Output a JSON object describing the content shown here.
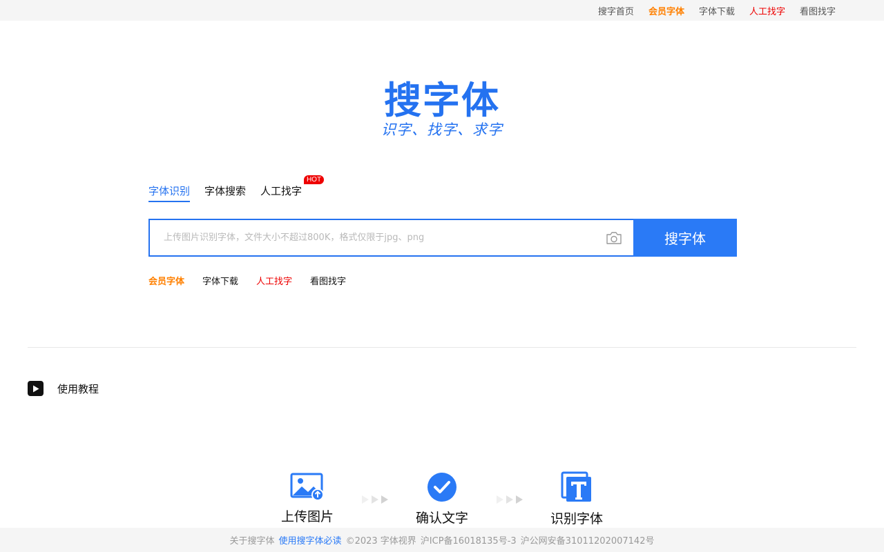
{
  "topnav": {
    "items": [
      {
        "label": "搜字首页"
      },
      {
        "label": "会员字体"
      },
      {
        "label": "字体下载"
      },
      {
        "label": "人工找字"
      },
      {
        "label": "看图找字"
      }
    ]
  },
  "logo": {
    "title": "搜字体",
    "slogan": "识字、找字、求字"
  },
  "tabs": [
    {
      "label": "字体识别",
      "active": true
    },
    {
      "label": "字体搜索"
    },
    {
      "label": "人工找字",
      "badge": "HOT"
    }
  ],
  "search": {
    "placeholder": "上传图片识别字体，文件大小不超过800K，格式仅限于jpg、png",
    "button_label": "搜字体"
  },
  "quick_links": [
    {
      "label": "会员字体"
    },
    {
      "label": "字体下载"
    },
    {
      "label": "人工找字"
    },
    {
      "label": "看图找字"
    }
  ],
  "tutorial": {
    "label": "使用教程"
  },
  "steps": [
    {
      "label": "上传图片",
      "icon": "upload-image-icon"
    },
    {
      "label": "确认文字",
      "icon": "check-circle-icon"
    },
    {
      "label": "识别字体",
      "icon": "font-t-icon"
    }
  ],
  "footer": {
    "about": "关于搜字体",
    "must_read": "使用搜字体必读",
    "copyright": "©2023 字体视界",
    "icp": "沪ICP备16018135号-3",
    "police": "沪公网安备31011202007142号"
  },
  "colors": {
    "brand": "#2472f0",
    "button": "#2a7af6",
    "vip": "#ff8000",
    "hot": "#ee0000"
  }
}
